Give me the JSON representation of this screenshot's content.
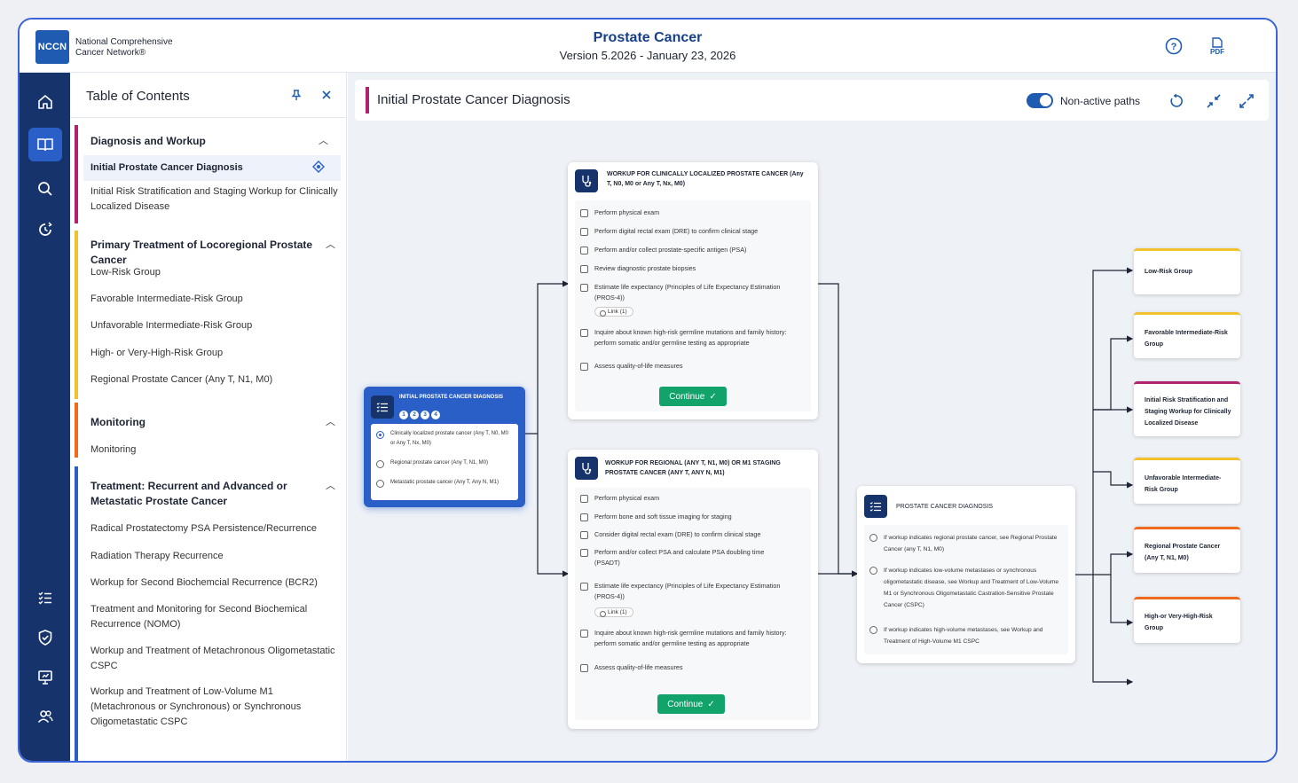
{
  "app": {
    "logo": "NCCN",
    "org_line1": "National Comprehensive",
    "org_line2": "Cancer Network®",
    "title": "Prostate Cancer",
    "version": "Version 5.2026 - January 23, 2026",
    "pdf_label": "PDF"
  },
  "toc": {
    "title": "Table of Contents",
    "sections": [
      {
        "title": "Diagnosis and Workup",
        "color": "#b0246d",
        "items": [
          "Initial Prostate Cancer Diagnosis",
          "Initial Risk Stratification and Staging Workup for Clinically Localized Disease"
        ]
      },
      {
        "title": "Primary Treatment of Locoregional Prostate Cancer",
        "color": "#f2c12e",
        "items": [
          "Low-Risk Group",
          "Favorable Intermediate-Risk Group",
          "Unfavorable Intermediate-Risk Group",
          "High- or Very-High-Risk Group",
          "Regional Prostate Cancer (Any T, N1, M0)"
        ]
      },
      {
        "title": "Monitoring",
        "color": "#f06a1e",
        "items": [
          "Monitoring"
        ]
      },
      {
        "title": "Treatment: Recurrent and Advanced or Metastatic Prostate Cancer",
        "color": "#2a5fc7",
        "items": [
          "Radical Prostatectomy PSA Persistence/Recurrence",
          "Radiation Therapy Recurrence",
          "Workup for Second Biochemcial Recurrence (BCR2)",
          "Treatment and Monitoring for Second Biochemical Recurrence (NOMO)",
          "Workup and Treatment of Metachronous Oligometastatic CSPC",
          "Workup and Treatment of Low-Volume M1 (Metachronous or Synchronous) or Synchronous Oligometastatic CSPC"
        ]
      }
    ]
  },
  "main": {
    "title": "Initial Prostate Cancer Diagnosis",
    "toggle_label": "Non-active paths",
    "toggle_on": true
  },
  "start_card": {
    "title": "INITIAL PROSTATE CANCER DIAGNOSIS",
    "steps": [
      "1",
      "2",
      "3",
      "4"
    ],
    "options": [
      "Clinically localized prostate cancer (Any T, N0, M0 or Any T, Nx, M0)",
      "Regional prostate cancer (Any T, N1, M0)",
      "Metastatic prostate cancer (Any T, Any N, M1)"
    ],
    "selected": 0
  },
  "workup_localized": {
    "title": "WORKUP FOR CLINICALLY LOCALIZED PROSTATE CANCER (Any T, N0, M0 or Any T, Nx, M0)",
    "items": [
      "Perform physical exam",
      "Perform digital rectal exam (DRE) to confirm clinical stage",
      "Perform and/or collect prostate-specific antigen (PSA)",
      "Review diagnostic prostate biopsies",
      "Estimate life expectancy (Principles of Life Expectancy Estimation (PROS-4))",
      "Inquire about known high-risk germline mutations and family history: perform somatic and/or germline testing as appropriate",
      "Assess quality-of-life measures"
    ],
    "link": "Link (1)",
    "continue": "Continue"
  },
  "workup_regional": {
    "title": "WORKUP FOR REGIONAL (ANY T, N1, M0) OR M1 STAGING PROSTATE CANCER (ANY T, ANY N, M1)",
    "items": [
      "Perform physical exam",
      "Perform bone and soft tissue imaging for staging",
      "Consider digital rectal exam (DRE) to confirm clinical stage",
      "Perform and/or collect PSA and calculate PSA doubling time (PSADT)",
      "Estimate life expectancy (Principles of Life Expectancy Estimation (PROS-4))",
      "Inquire about known high-risk germline mutations and family history: perform somatic and/or germline testing as appropriate",
      "Assess quality-of-life measures"
    ],
    "link": "Link (1)",
    "continue": "Continue"
  },
  "diagnosis_card": {
    "title": "PROSTATE CANCER DIAGNOSIS",
    "options": [
      "If workup indicates regional prostate cancer, see Regional Prostate Cancer (any T, N1, M0)",
      "If workup indicates low-volume metastases or synchronous oligometastatic disease, see Workup and Treatment of Low-Volume M1 or Synchronous Oligometastatic Castration-Sensitive Prostate Cancer (CSPC)",
      "If workup indicates high-volume metastases, see Workup and Treatment of High-Volume M1 CSPC"
    ]
  },
  "outcomes": [
    {
      "label": "Low-Risk Group",
      "color": "#f2c12e"
    },
    {
      "label": "Favorable Intermediate-Risk Group",
      "color": "#f2c12e"
    },
    {
      "label": "Initial Risk Stratification and Staging Workup for Clinically Localized Disease",
      "color": "#b0246d"
    },
    {
      "label": "Unfavorable Intermediate-Risk Group",
      "color": "#f2c12e"
    },
    {
      "label": "Regional Prostate Cancer (Any T, N1, M0)",
      "color": "#f06a1e"
    },
    {
      "label": "High-or Very-High-Risk Group",
      "color": "#f06a1e"
    }
  ]
}
